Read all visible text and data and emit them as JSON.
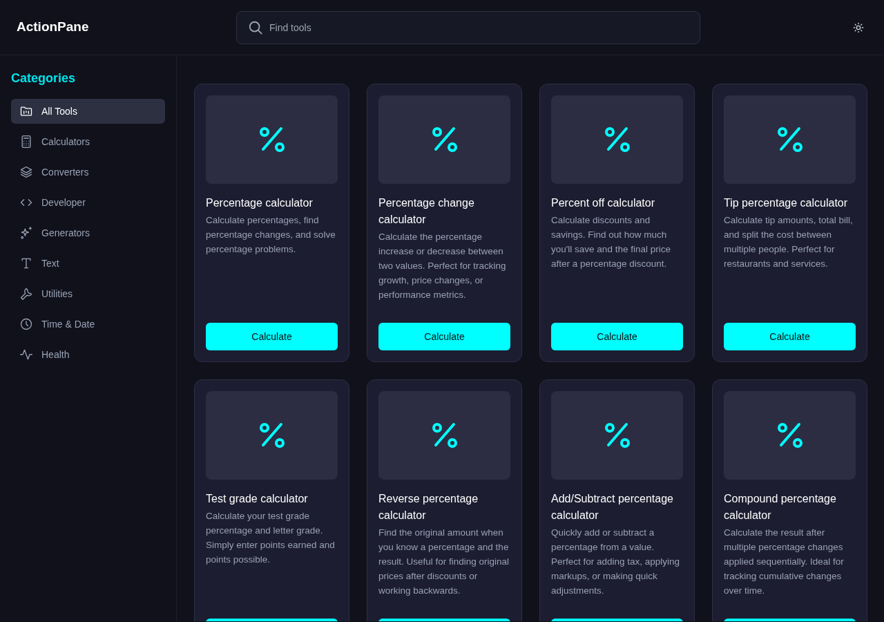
{
  "header": {
    "logo": "ActionPane",
    "search": {
      "placeholder": "Find tools"
    }
  },
  "sidebar": {
    "title": "Categories",
    "items": [
      {
        "label": "All Tools",
        "selected": true
      },
      {
        "label": "Calculators",
        "selected": false
      },
      {
        "label": "Converters",
        "selected": false
      },
      {
        "label": "Developer",
        "selected": false
      },
      {
        "label": "Generators",
        "selected": false
      },
      {
        "label": "Text",
        "selected": false
      },
      {
        "label": "Utilities",
        "selected": false
      },
      {
        "label": "Time & Date",
        "selected": false
      },
      {
        "label": "Health",
        "selected": false
      }
    ]
  },
  "tools": [
    {
      "title": "Percentage calculator",
      "description": "Calculate percentages, find percentage changes, and solve percentage problems.",
      "button": "Calculate"
    },
    {
      "title": "Percentage change calculator",
      "description": "Calculate the percentage increase or decrease between two values. Perfect for tracking growth, price changes, or performance metrics.",
      "button": "Calculate"
    },
    {
      "title": "Percent off calculator",
      "description": "Calculate discounts and savings. Find out how much you'll save and the final price after a percentage discount.",
      "button": "Calculate"
    },
    {
      "title": "Tip percentage calculator",
      "description": "Calculate tip amounts, total bill, and split the cost between multiple people. Perfect for restaurants and services.",
      "button": "Calculate"
    },
    {
      "title": "Test grade calculator",
      "description": "Calculate your test grade percentage and letter grade. Simply enter points earned and points possible."
    },
    {
      "title": "Reverse percentage calculator",
      "description": "Find the original amount when you know a percentage and the result. Useful for finding original prices after discounts or working backwards."
    },
    {
      "title": "Add/Subtract percentage calculator",
      "description": "Quickly add or subtract a percentage from a value. Perfect for adding tax, applying markups, or making quick adjustments."
    },
    {
      "title": "Compound percentage calculator",
      "description": "Calculate the result after multiple percentage changes applied sequentially. Ideal for tracking cumulative changes over time."
    }
  ]
}
